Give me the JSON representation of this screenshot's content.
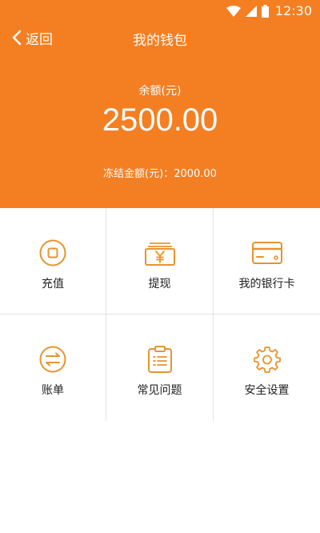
{
  "status_bar": {
    "time": "12:30",
    "icons": [
      "wifi-icon",
      "signal-icon",
      "battery-icon"
    ]
  },
  "nav": {
    "back_label": "返回",
    "title": "我的钱包"
  },
  "balance": {
    "label": "余额(元)",
    "value": "2500.00",
    "frozen_label": "冻结金额(元)：",
    "frozen_value": "2000.00"
  },
  "menu": [
    {
      "label": "充值",
      "icon": "recharge-icon"
    },
    {
      "label": "提现",
      "icon": "withdraw-icon"
    },
    {
      "label": "我的银行卡",
      "icon": "bank-card-icon"
    },
    {
      "label": "账单",
      "icon": "bill-icon"
    },
    {
      "label": "常见问题",
      "icon": "faq-icon"
    },
    {
      "label": "安全设置",
      "icon": "gear-icon"
    }
  ],
  "colors": {
    "accent": "#f47f22",
    "icon": "#e6942e",
    "text": "#222222",
    "divider": "#e3e3e3"
  }
}
